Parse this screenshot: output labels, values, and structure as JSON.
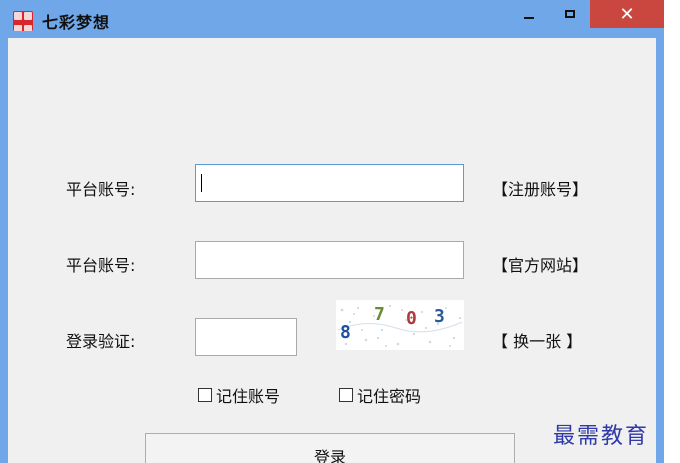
{
  "window": {
    "title": "七彩梦想",
    "close_symbol": "✕",
    "colors": {
      "titlebar": "#6fa7e8",
      "close": "#c9473e",
      "client": "#f0f0f0"
    }
  },
  "form": {
    "account_label": "平台账号:",
    "account_value": "",
    "password_label": "平台账号:",
    "password_value": "",
    "captcha_label": "登录验证:",
    "captcha_value": "",
    "captcha_text": [
      "8",
      "7",
      "0",
      "3"
    ],
    "register_link": "【注册账号】",
    "website_link": "【官方网站】",
    "refresh_link": "【 换一张 】",
    "remember_account": {
      "label": "记住账号",
      "checked": false
    },
    "remember_password": {
      "label": "记住密码",
      "checked": false
    },
    "login_button": "登录"
  },
  "watermark": "最需教育"
}
